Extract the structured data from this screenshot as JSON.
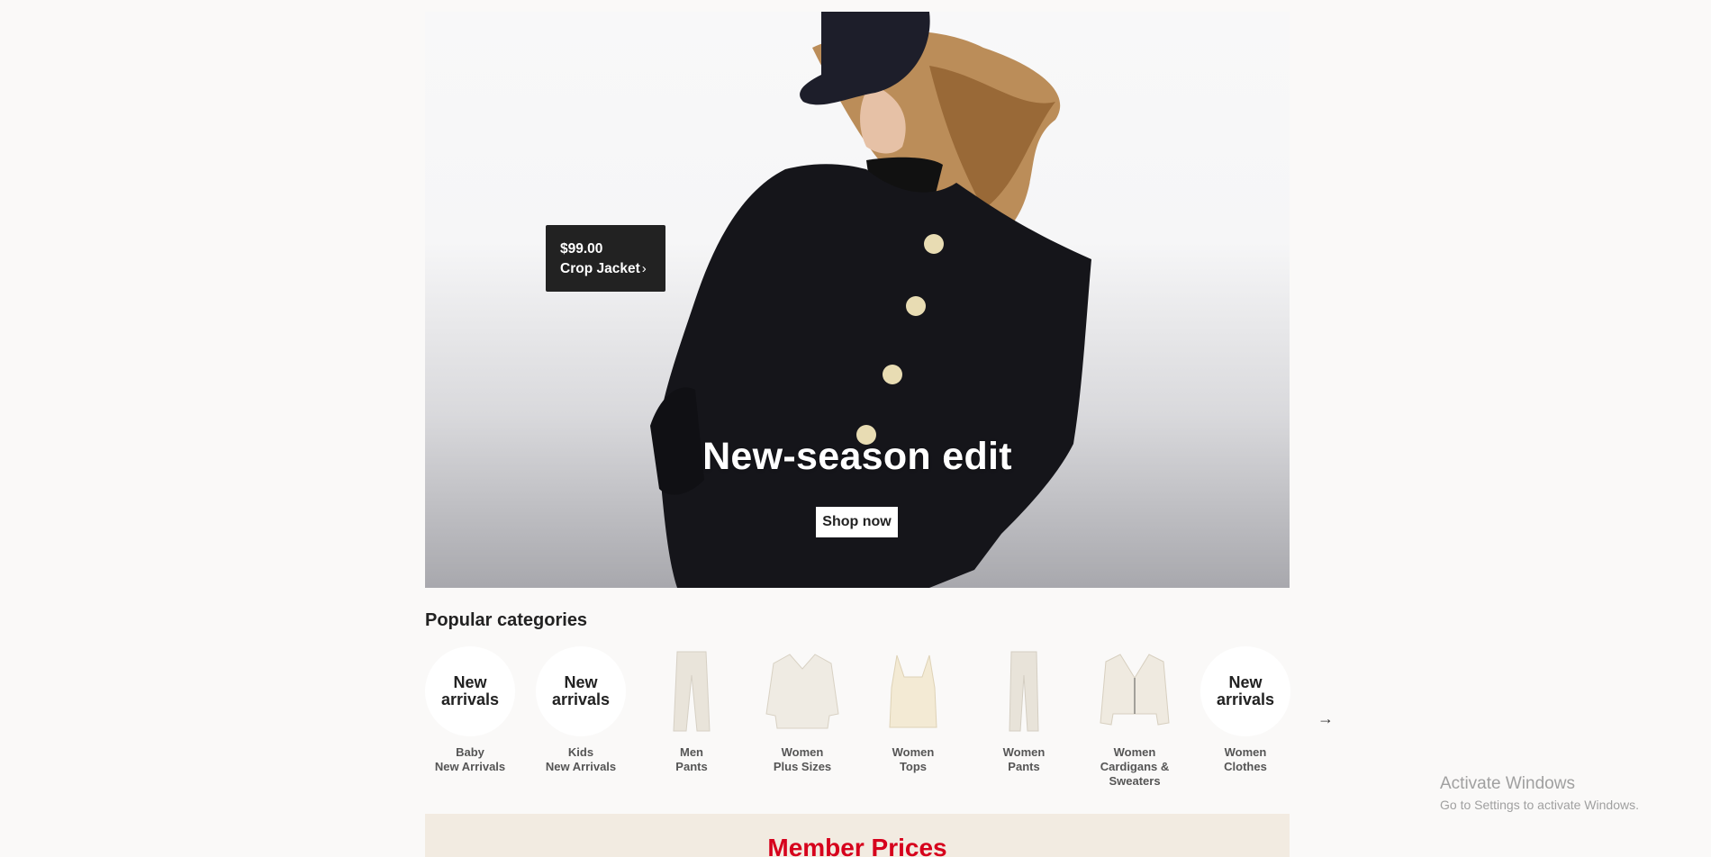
{
  "hero": {
    "title": "New-season edit",
    "cta_label": "Shop now",
    "price_tag": {
      "price": "$99.00",
      "product": "Crop Jacket",
      "chevron": "›"
    }
  },
  "categories": {
    "heading": "Popular categories",
    "next_icon": "→",
    "items": [
      {
        "thumb": "circle",
        "circle_text": "New arrivals",
        "line1": "Baby",
        "line2": "New Arrivals"
      },
      {
        "thumb": "circle",
        "circle_text": "New arrivals",
        "line1": "Kids",
        "line2": "New Arrivals"
      },
      {
        "thumb": "pants-icon",
        "line1": "Men",
        "line2": "Pants"
      },
      {
        "thumb": "blouse-icon",
        "line1": "Women",
        "line2": "Plus Sizes"
      },
      {
        "thumb": "tank-top-icon",
        "line1": "Women",
        "line2": "Tops"
      },
      {
        "thumb": "pants-icon",
        "line1": "Women",
        "line2": "Pants"
      },
      {
        "thumb": "cardigan-icon",
        "line1": "Women",
        "line2": "Cardigans &",
        "line3": "Sweaters"
      },
      {
        "thumb": "circle",
        "circle_text": "New arrivals",
        "line1": "Women",
        "line2": "Clothes"
      }
    ]
  },
  "member": {
    "title": "Member Prices"
  },
  "watermark": {
    "line1": "Activate Windows",
    "line2": "Go to Settings to activate Windows."
  },
  "colors": {
    "background": "#faf9f8",
    "member_red": "#d6001c",
    "member_bg": "#f2ebe1"
  }
}
